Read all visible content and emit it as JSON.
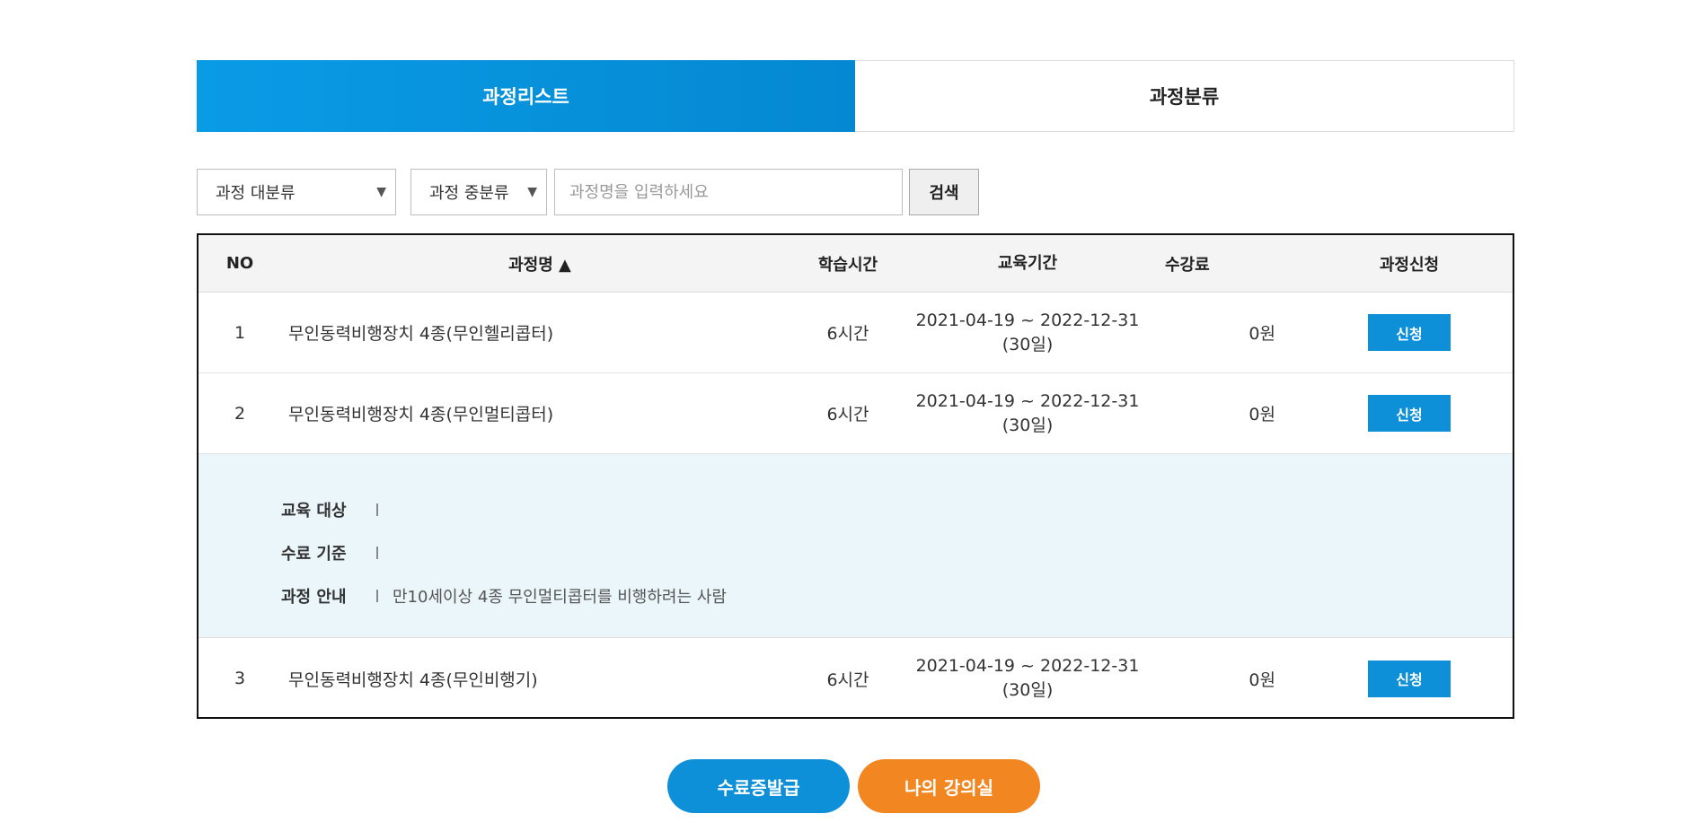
{
  "tabs": [
    {
      "label": "과정리스트",
      "active": true
    },
    {
      "label": "과정분류",
      "active": false
    }
  ],
  "filters": {
    "category_major": "과정 대분류",
    "category_middle": "과정 중분류",
    "search_placeholder": "과정명을 입력하세요",
    "search_button": "검색"
  },
  "table": {
    "headers": {
      "no": "NO",
      "title": "과정명 ▲",
      "time": "학습시간",
      "period": "교육기간",
      "fee": "수강료",
      "apply": "과정신청"
    },
    "rows": [
      {
        "no": "1",
        "title": "무인동력비행장치 4종(무인헬리콥터)",
        "time": "6시간",
        "period_range": "2021-04-19 ~ 2022-12-31",
        "period_days": "(30일)",
        "fee": "0원",
        "apply_label": "신청"
      },
      {
        "no": "2",
        "title": "무인동력비행장치 4종(무인멀티콥터)",
        "time": "6시간",
        "period_range": "2021-04-19 ~ 2022-12-31",
        "period_days": "(30일)",
        "fee": "0원",
        "apply_label": "신청"
      },
      {
        "no": "3",
        "title": "무인동력비행장치 4종(무인비행기)",
        "time": "6시간",
        "period_range": "2021-04-19 ~ 2022-12-31",
        "period_days": "(30일)",
        "fee": "0원",
        "apply_label": "신청"
      }
    ],
    "detail": {
      "target_label": "교육 대상",
      "target_value": "",
      "criteria_label": "수료 기준",
      "criteria_value": "",
      "guide_label": "과정 안내",
      "guide_value": "만10세이상 4종 무인멀티콥터를 비행하려는 사람"
    }
  },
  "buttons": {
    "certificate": "수료증발급",
    "my_classroom": "나의 강의실"
  },
  "colors": {
    "primary_blue": "#0e90d9",
    "orange": "#f28621",
    "detail_bg": "#eaf6fa"
  }
}
